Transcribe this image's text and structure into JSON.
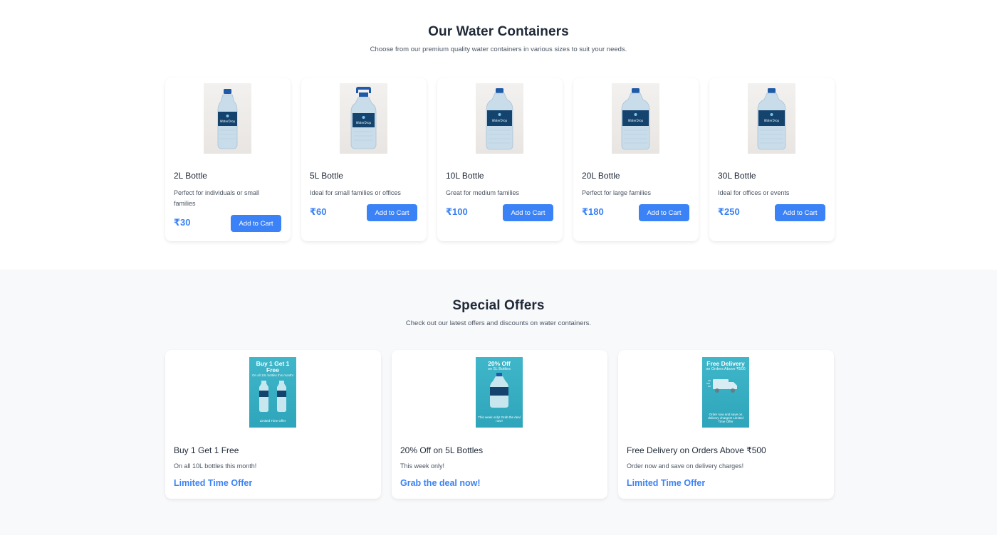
{
  "products_section": {
    "title": "Our Water Containers",
    "subtitle": "Choose from our premium quality water containers in various sizes to suit your needs.",
    "products": [
      {
        "name": "2L Bottle",
        "description": "Perfect for individuals or small families",
        "price": "₹30",
        "button_label": "Add to Cart",
        "image_icon": "bottle-2l-icon",
        "brand": "WaterDrop"
      },
      {
        "name": "5L Bottle",
        "description": "Ideal for small families or offices",
        "price": "₹60",
        "button_label": "Add to Cart",
        "image_icon": "bottle-5l-icon",
        "brand": "WaterDrop"
      },
      {
        "name": "10L Bottle",
        "description": "Great for medium families",
        "price": "₹100",
        "button_label": "Add to Cart",
        "image_icon": "bottle-10l-icon",
        "brand": "WaterDrop"
      },
      {
        "name": "20L Bottle",
        "description": "Perfect for large families",
        "price": "₹180",
        "button_label": "Add to Cart",
        "image_icon": "bottle-20l-icon",
        "brand": "WaterDrop"
      },
      {
        "name": "30L Bottle",
        "description": "Ideal for offices or events",
        "price": "₹250",
        "button_label": "Add to Cart",
        "image_icon": "bottle-30l-icon",
        "brand": "WaterDrop"
      }
    ]
  },
  "offers_section": {
    "title": "Special Offers",
    "subtitle": "Check out our latest offers and discounts on water containers.",
    "offers": [
      {
        "title": "Buy 1 Get 1 Free",
        "description": "On all 10L bottles this month!",
        "link_label": "Limited Time Offer",
        "poster": {
          "headline": "Buy 1 Get 1 Free",
          "subline": "On all 10L bottles this month!",
          "footer": "Limited Time Offer",
          "icon": "two-bottles-icon"
        }
      },
      {
        "title": "20% Off on 5L Bottles",
        "description": "This week only!",
        "link_label": "Grab the deal now!",
        "poster": {
          "headline": "20% Off",
          "subline": "on 5L Bottles",
          "footer": "This week only! Grab the deal now!",
          "icon": "bottle-icon"
        }
      },
      {
        "title": "Free Delivery on Orders Above ₹500",
        "description": "Order now and save on delivery charges!",
        "link_label": "Limited Time Offer",
        "poster": {
          "headline": "Free Delivery",
          "subline": "on Orders Above ₹500",
          "footer": "Order now and save on delivery charges! Limited Time Offer",
          "icon": "truck-icon"
        }
      }
    ]
  },
  "colors": {
    "accent": "#3b82f6",
    "heading": "#1f2937",
    "muted": "#4b5563",
    "offers_bg": "#f8f9fb",
    "poster_teal": "#33aec3",
    "label_navy": "#14436e"
  }
}
